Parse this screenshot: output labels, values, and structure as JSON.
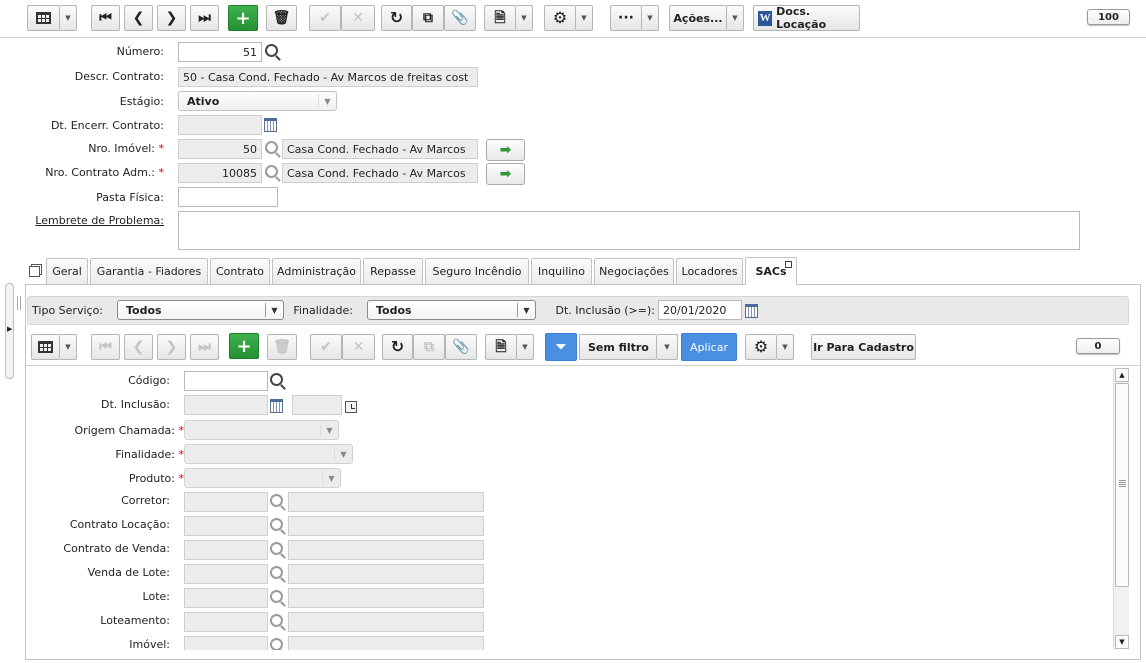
{
  "toolbar": {
    "actions_label": "Ações...",
    "docs_label": "Docs. Locação",
    "counter": "100"
  },
  "form": {
    "numero_label": "Número:",
    "numero_value": "51",
    "descr_label": "Descr. Contrato:",
    "descr_value": "50 - Casa Cond. Fechado - Av Marcos de freitas cost",
    "estagio_label": "Estágio:",
    "estagio_value": "Ativo",
    "dt_encerr_label": "Dt. Encerr. Contrato:",
    "nro_imovel_label": "Nro. Imóvel:",
    "nro_imovel_value": "50",
    "nro_imovel_desc": "Casa Cond. Fechado - Av Marcos",
    "nro_contrato_adm_label": "Nro. Contrato Adm.:",
    "nro_contrato_adm_value": "10085",
    "nro_contrato_adm_desc": "Casa Cond. Fechado - Av Marcos",
    "pasta_label": "Pasta Física:",
    "lembrete_label": "Lembrete de Problema:"
  },
  "tabs": [
    {
      "label": "Geral"
    },
    {
      "label": "Garantia - Fiadores"
    },
    {
      "label": "Contrato"
    },
    {
      "label": "Administração"
    },
    {
      "label": "Repasse"
    },
    {
      "label": "Seguro Incêndio"
    },
    {
      "label": "Inquilino"
    },
    {
      "label": "Negociações"
    },
    {
      "label": "Locadores"
    },
    {
      "label": "SACs"
    }
  ],
  "filter": {
    "tipo_label": "Tipo Serviço:",
    "tipo_value": "Todos",
    "finalidade_label": "Finalidade:",
    "finalidade_value": "Todos",
    "dt_inclusao_label": "Dt. Inclusão (>=):",
    "dt_inclusao_value": "20/01/2020"
  },
  "subtoolbar": {
    "sem_filtro_label": "Sem filtro",
    "aplicar_label": "Aplicar",
    "ir_cadastro_label": "Ir Para Cadastro",
    "counter": "0"
  },
  "sac": {
    "codigo_label": "Código:",
    "dt_inclusao_label": "Dt. Inclusão:",
    "origem_label": "Origem Chamada:",
    "finalidade_label": "Finalidade:",
    "produto_label": "Produto:",
    "corretor_label": "Corretor:",
    "contrato_locacao_label": "Contrato Locação:",
    "contrato_venda_label": "Contrato de Venda:",
    "venda_lote_label": "Venda de Lote:",
    "lote_label": "Lote:",
    "loteamento_label": "Loteamento:",
    "imovel_label": "Imóvel:"
  },
  "colors": {
    "green": "#2f9a3a",
    "blue": "#4a90e2",
    "required": "#dd0000"
  }
}
